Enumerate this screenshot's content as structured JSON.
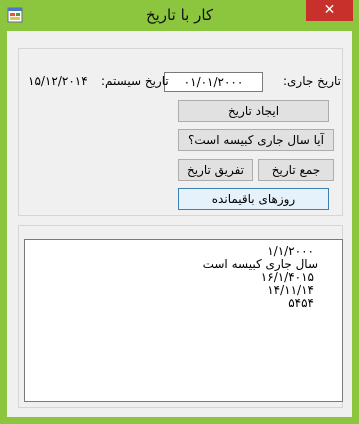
{
  "window": {
    "title": "کار با تاریخ",
    "close_label": "✕"
  },
  "form": {
    "current_date_label": "تاریخ جاری:",
    "current_date_value": "۰۱/۰۱/۲۰۰۰",
    "system_date_label": "تاریخ سیستم:",
    "system_date_value": "۱۵/۱۲/۲۰۱۴"
  },
  "buttons": {
    "create_date": "ایجاد تاریخ",
    "is_leap_year": "آیا سال جاری کبیسه است؟",
    "add_date": "جمع تاریخ",
    "subtract_date": "تفریق تاریخ",
    "remaining_days": "روزهای باقیمانده"
  },
  "output_lines": [
    "۱/۱/۲۰۰۰",
    "سال جاری کبیسه است",
    "۱۶/۱/۴۰۱۵",
    "۱۴/۱۱/۱۴",
    "۵۴۵۴"
  ],
  "colors": {
    "frame": "#8cc63f",
    "close": "#c7302b",
    "client": "#f0f0f0"
  }
}
